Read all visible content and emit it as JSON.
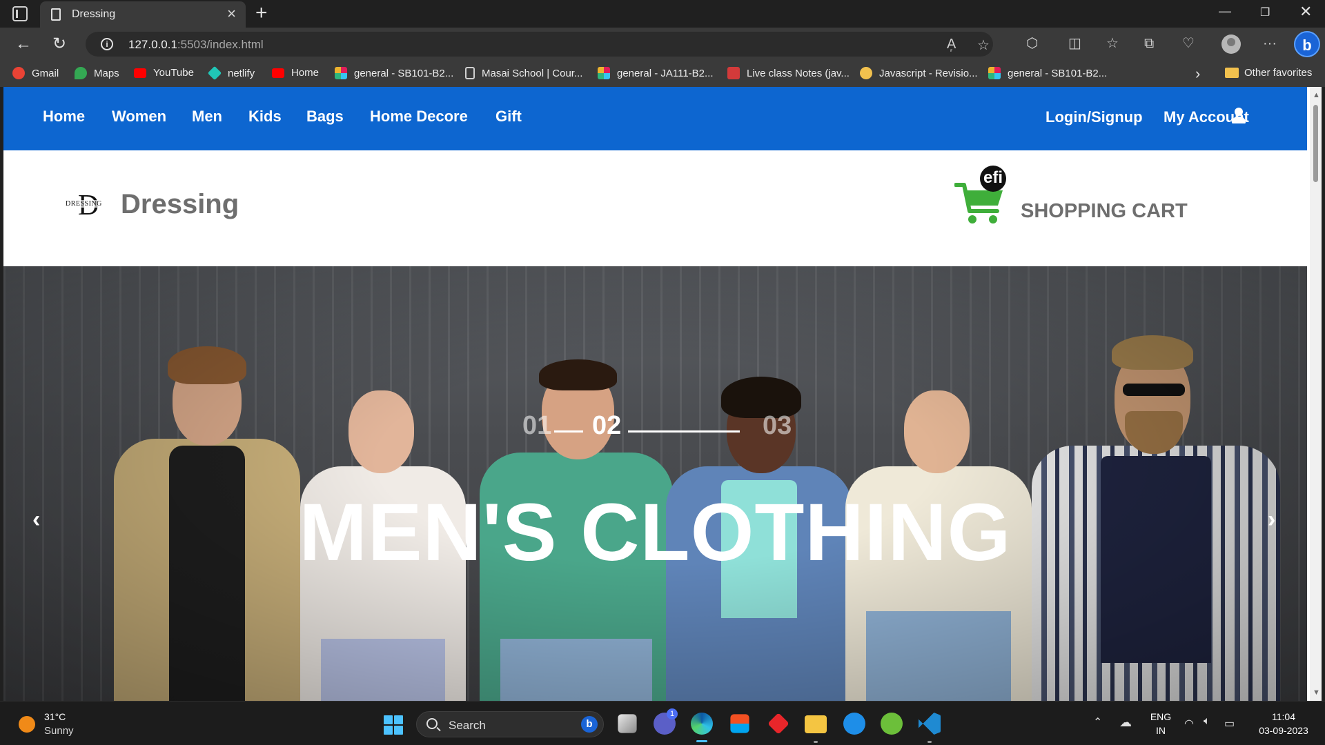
{
  "browser": {
    "tab_title": "Dressing",
    "url_host": "127.0.0.1",
    "url_rest": ":5503/index.html",
    "bookmarks": [
      {
        "label": "Gmail",
        "color": "#ea4335"
      },
      {
        "label": "Maps",
        "color": "#34a853"
      },
      {
        "label": "YouTube",
        "color": "#ff0000"
      },
      {
        "label": "netlify",
        "color": "#20c6b7"
      },
      {
        "label": "Home",
        "color": "#ff0000"
      },
      {
        "label": "general - SB101-B2...",
        "color": "#e01e5a"
      },
      {
        "label": "Masai School | Cour...",
        "color": "#d0d0d0"
      },
      {
        "label": "general - JA111-B2...",
        "color": "#36c5f0"
      },
      {
        "label": "Live class Notes (jav...",
        "color": "#d33a3a"
      },
      {
        "label": "Javascript - Revisio...",
        "color": "#f2c14e"
      },
      {
        "label": "general - SB101-B2...",
        "color": "#2eb67d"
      }
    ],
    "other_favorites": "Other favorites"
  },
  "site": {
    "nav": [
      "Home",
      "Women",
      "Men",
      "Kids",
      "Bags",
      "Home Decore",
      "Gift"
    ],
    "login_label": "Login/Signup",
    "account_label": "My Account",
    "brand_logo_big": "D",
    "brand_logo_small": "DRESSING",
    "brand_name": "Dressing",
    "cart_badge": "efi",
    "cart_label": "SHOPPING CART",
    "accent_color": "#0d66d0",
    "cart_color": "#3fae3a"
  },
  "hero": {
    "slide_numbers": [
      "01",
      "02",
      "03"
    ],
    "active_slide": "02",
    "title": "MEN'S CLOTHING",
    "prev_arrow": "‹",
    "next_arrow": "›"
  },
  "taskbar": {
    "weather_temp": "31°C",
    "weather_cond": "Sunny",
    "search_label": "Search",
    "lang_top": "ENG",
    "lang_bottom": "IN",
    "time": "11:04",
    "date": "03-09-2023",
    "teams_badge": "1"
  }
}
